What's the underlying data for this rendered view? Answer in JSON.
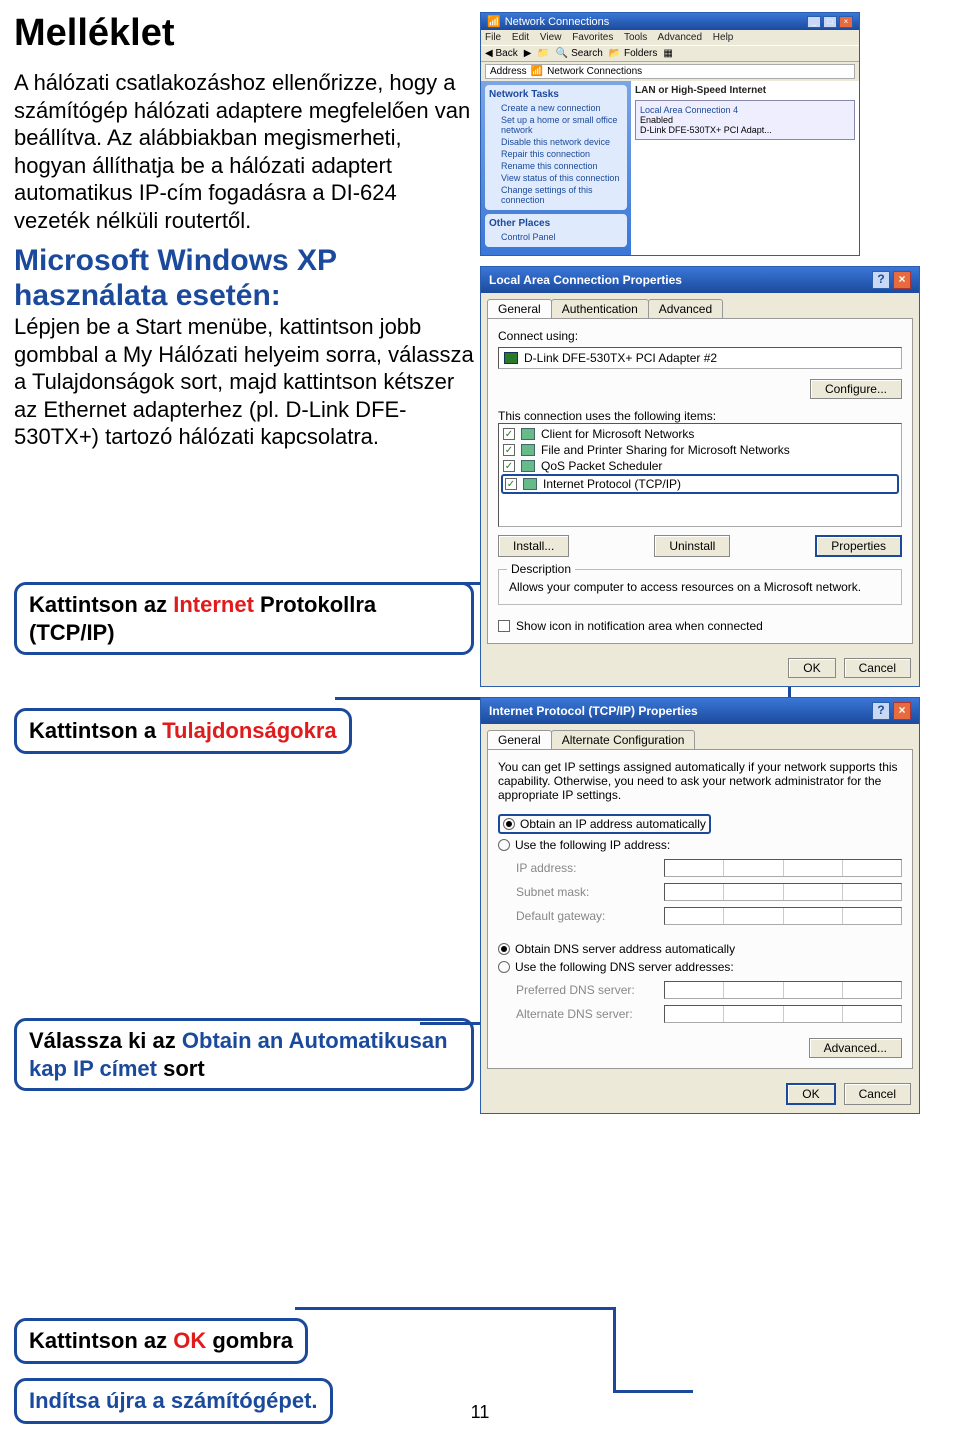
{
  "page_number": "11",
  "left": {
    "title": "Melléklet",
    "p1": "A hálózati csatlakozáshoz ellenőrizze, hogy a számítógép hálózati adaptere megfelelően van beállítva. Az alábbiakban megismerheti, hogyan állíthatja be a hálózati adaptert automatikus IP-cím fogadásra a DI-624 vezeték nélküli routertől.",
    "xp_head": "Microsoft Windows XP használata esetén:",
    "p2": "Lépjen be a Start menübe, kattintson jobb gombbal a My Hálózati helyeim sorra, válassza a Tulajdonságok sort, majd kattintson kétszer az Ethernet adapterhez (pl. D-Link DFE-530TX+) tartozó hálózati kapcsolatra.",
    "callout_internet_a": "Kattintson az ",
    "callout_internet_b": "Internet",
    "callout_internet_c": " Protokollra (TCP/IP)",
    "callout_tul_a": "Kattintson a ",
    "callout_tul_b": "Tulajdonságokra",
    "callout_obtain_a": "Válassza ki az ",
    "callout_obtain_b": "Obtain an Automatikusan kap IP címet",
    "callout_obtain_c": " sort",
    "callout_ok_a": "Kattintson az ",
    "callout_ok_b": "OK",
    "callout_ok_c": " gombra",
    "callout_restart": "Indítsa újra a számítógépet."
  },
  "nc": {
    "title": "Network Connections",
    "menu": {
      "file": "File",
      "edit": "Edit",
      "view": "View",
      "fav": "Favorites",
      "tools": "Tools",
      "adv": "Advanced",
      "help": "Help"
    },
    "toolbar": {
      "back": "Back",
      "search": "Search",
      "folders": "Folders"
    },
    "address_label": "Address",
    "address": "Network Connections",
    "tasks_head": "Network Tasks",
    "tasks": [
      "Create a new connection",
      "Set up a home or small office network",
      "Disable this network device",
      "Repair this connection",
      "Rename this connection",
      "View status of this connection",
      "Change settings of this connection"
    ],
    "places_head": "Other Places",
    "places": [
      "Control Panel"
    ],
    "main_head": "LAN or High-Speed Internet",
    "item_name": "Local Area Connection 4",
    "item_status": "Enabled",
    "item_dev": "D-Link DFE-530TX+ PCI Adapt..."
  },
  "lan": {
    "title": "Local Area Connection Properties",
    "tab_general": "General",
    "tab_auth": "Authentication",
    "tab_adv": "Advanced",
    "connect_using": "Connect using:",
    "adapter": "D-Link DFE-530TX+ PCI Adapter #2",
    "configure": "Configure...",
    "items_label": "This connection uses the following items:",
    "items": [
      "Client for Microsoft Networks",
      "File and Printer Sharing for Microsoft Networks",
      "QoS Packet Scheduler",
      "Internet Protocol (TCP/IP)"
    ],
    "install": "Install...",
    "uninstall": "Uninstall",
    "properties": "Properties",
    "desc_head": "Description",
    "desc": "Allows your computer to access resources on a Microsoft network.",
    "show_icon": "Show icon in notification area when connected",
    "ok": "OK",
    "cancel": "Cancel"
  },
  "tcp": {
    "title": "Internet Protocol (TCP/IP) Properties",
    "tab_general": "General",
    "tab_alt": "Alternate Configuration",
    "blurb": "You can get IP settings assigned automatically if your network supports this capability. Otherwise, you need to ask your network administrator for the appropriate IP settings.",
    "r_auto": "Obtain an IP address automatically",
    "r_use": "Use the following IP address:",
    "ip": "IP address:",
    "mask": "Subnet mask:",
    "gw": "Default gateway:",
    "r_dns_auto": "Obtain DNS server address automatically",
    "r_dns_use": "Use the following DNS server addresses:",
    "pdns": "Preferred DNS server:",
    "adns": "Alternate DNS server:",
    "advanced": "Advanced...",
    "ok": "OK",
    "cancel": "Cancel"
  }
}
